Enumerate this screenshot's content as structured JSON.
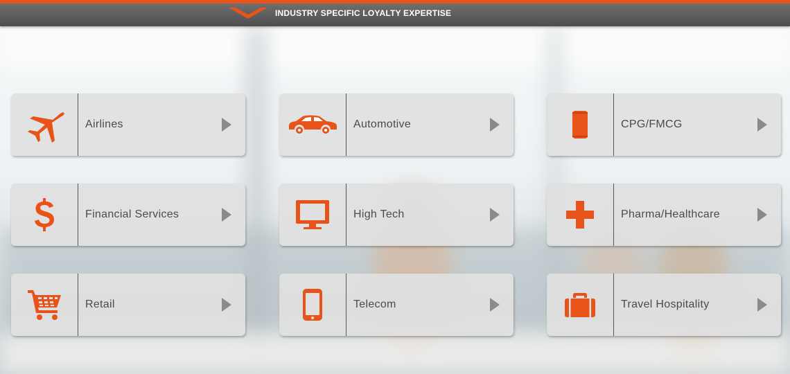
{
  "header": {
    "title": "INDUSTRY SPECIFIC LOYALTY EXPERTISE",
    "accent_color": "#e8531a"
  },
  "industries": [
    {
      "label": "Airlines",
      "icon": "airplane-icon"
    },
    {
      "label": "Automotive",
      "icon": "car-icon"
    },
    {
      "label": "CPG/FMCG",
      "icon": "can-icon"
    },
    {
      "label": "Financial Services",
      "icon": "dollar-icon"
    },
    {
      "label": "High Tech",
      "icon": "monitor-icon"
    },
    {
      "label": "Pharma/Healthcare",
      "icon": "medical-cross-icon"
    },
    {
      "label": "Retail",
      "icon": "shopping-cart-icon"
    },
    {
      "label": "Telecom",
      "icon": "phone-icon"
    },
    {
      "label": "Travel Hospitality",
      "icon": "briefcase-icon"
    }
  ],
  "colors": {
    "icon": "#e8531a",
    "tile_bg": "#e0e0e0",
    "label": "#4a4a4a",
    "arrow": "#8a8a8a"
  }
}
